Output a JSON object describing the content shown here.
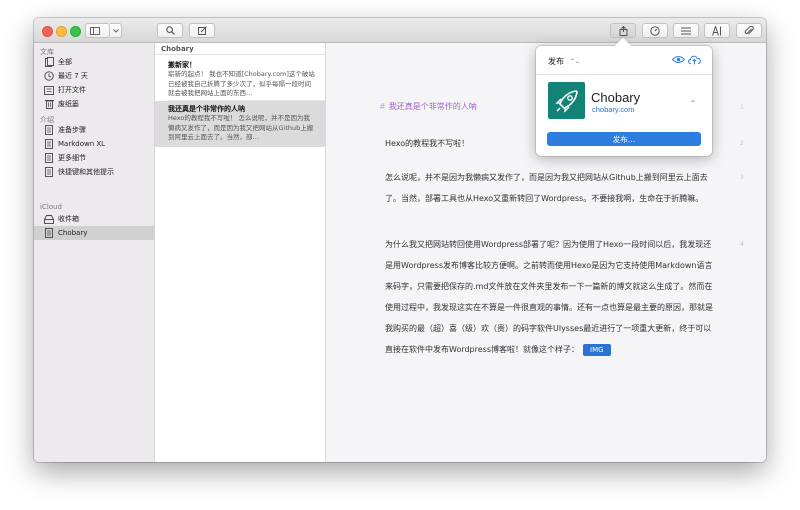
{
  "sidebar": {
    "library_label": "文库",
    "library_items": [
      {
        "label": "全部",
        "icon": "library-icon"
      },
      {
        "label": "最近 7 天",
        "icon": "clock-icon"
      },
      {
        "label": "打开文件",
        "icon": "open-files-icon"
      },
      {
        "label": "废纸篓",
        "icon": "trash-icon"
      }
    ],
    "intro_label": "介绍",
    "intro_items": [
      {
        "label": "准备步骤",
        "icon": "sheet-icon"
      },
      {
        "label": "Markdown XL",
        "icon": "sheet-icon"
      },
      {
        "label": "更多细节",
        "icon": "sheet-icon"
      },
      {
        "label": "快捷键和其他提示",
        "icon": "sheet-icon"
      }
    ],
    "icloud_label": "iCloud",
    "icloud_items": [
      {
        "label": "收件箱",
        "icon": "inbox-icon"
      },
      {
        "label": "Chobary",
        "icon": "sheet-icon",
        "selected": true
      }
    ]
  },
  "list": {
    "header": "Chobary",
    "cards": [
      {
        "title": "搬新家！",
        "preview": "崭新的起点！ 我也不知道[Chobary.com]这个破站已经被我自己折腾了多少次了，似乎每隔一段时间就会被我把网站上面的东西…"
      },
      {
        "title": "我还真是个非常作的人呐",
        "preview": "Hexo的教程我不写啦！ 怎么说呢，并不是因为我懒病又发作了，而是因为我又把网站从Github上搬到阿里云上面去了。当然，部…"
      }
    ]
  },
  "editor": {
    "heading_mark": "#",
    "heading": "我还真是个非常作的人呐",
    "paragraphs": [
      "Hexo的教程我不写啦！",
      "怎么说呢，并不是因为我懒病又发作了，而是因为我又把网站从Github上搬到阿里云上面去了。当然，部署工具也从Hexo又重新转回了Wordpress。不要接我啊，生命在于折腾嘛。",
      "为什么我又把网站转回使用Wordpress部署了呢？因为使用了Hexo一段时间以后，我发现还是用Wordpress发布博客比较方便啊。之前转而使用Hexo是因为它支持使用Markdown语言来码字，只需要把保存的.md文件放在文件夹里发布一下一篇新的博文就这么生成了。然而在使用过程中，我发现这实在不算是一件很直观的事情。还有一点也算是最主要的原因，那就是我购买的最（超）喜（级）欢（贵）的码字软件Ulysses最近进行了一项重大更新，终于可以直接在软件中发布Wordpress博客啦！就像这个样子："
    ],
    "img_chip": "IMG",
    "line_numbers": [
      "1",
      "2",
      "3",
      "4"
    ]
  },
  "publish_popover": {
    "mode": "发布",
    "site_name": "Chobary",
    "site_url": "chobary.com",
    "publish_button": "发布…",
    "accent": "#2e7ee0",
    "logo_bg": "#138377"
  },
  "colors": {
    "heading": "#a264c9",
    "selection": "#d0d0d0",
    "link": "#2a72d4"
  }
}
